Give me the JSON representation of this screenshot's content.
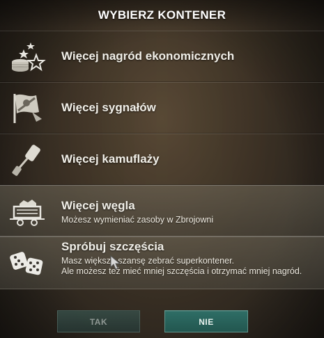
{
  "dialog": {
    "title": "WYBIERZ KONTENER"
  },
  "options": [
    {
      "label": "Więcej nagród ekonomicznych",
      "icon": "coins-star-icon"
    },
    {
      "label": "Więcej sygnałów",
      "icon": "signal-flag-icon"
    },
    {
      "label": "Więcej kamuflaży",
      "icon": "paint-roller-icon"
    },
    {
      "label": "Więcej węgla",
      "icon": "coal-cart-icon",
      "description": "Możesz wymieniać zasoby w Zbrojowni"
    },
    {
      "label": "Spróbuj szczęścia",
      "icon": "dice-icon",
      "description": "Masz większą szansę zebrać superkontener.\nAle możesz też mieć mniej szczęścia i otrzymać mniej nagród."
    }
  ],
  "buttons": {
    "yes": "TAK",
    "no": "NIE"
  },
  "colors": {
    "accent": "#2a6a62",
    "selected_row": "#5f5a4e"
  }
}
